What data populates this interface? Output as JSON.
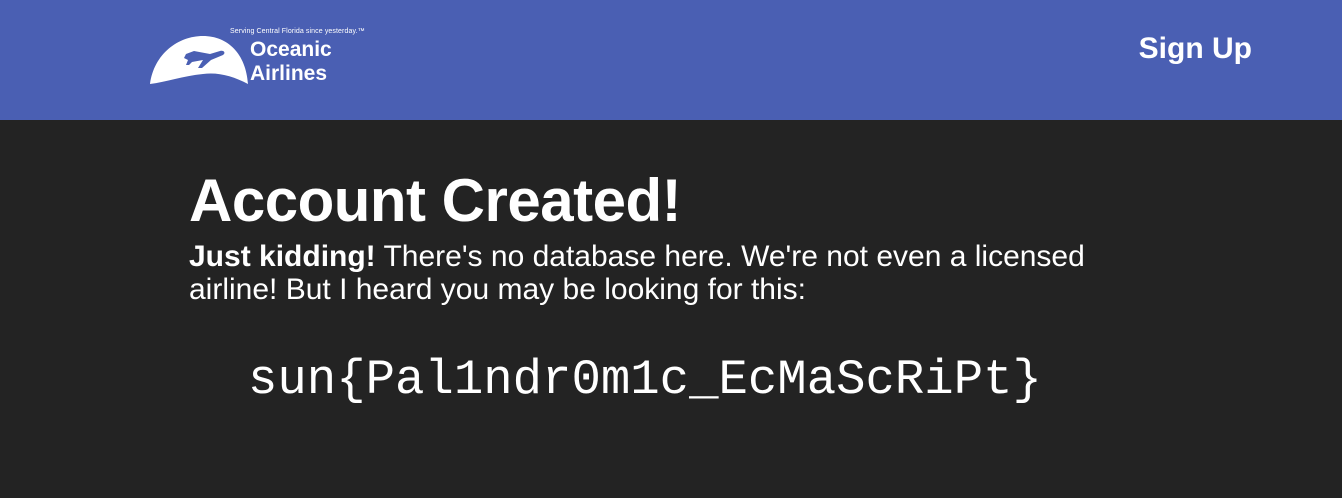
{
  "header": {
    "logo": {
      "tagline": "Serving Central Florida since yesterday.™",
      "name_line1": "Oceanic",
      "name_line2": "Airlines",
      "icon": "airplane-icon"
    },
    "nav": {
      "signup_label": "Sign Up"
    }
  },
  "main": {
    "title": "Account Created!",
    "message_strong": "Just kidding!",
    "message_rest": " There's no database here. We're not even a licensed airline! But I heard you may be looking for this:",
    "flag": "sun{Pal1ndr0m1c_EcMaScRiPt}"
  },
  "colors": {
    "header_bg": "#4a5fb3",
    "page_bg": "#232323",
    "text": "#ffffff"
  }
}
